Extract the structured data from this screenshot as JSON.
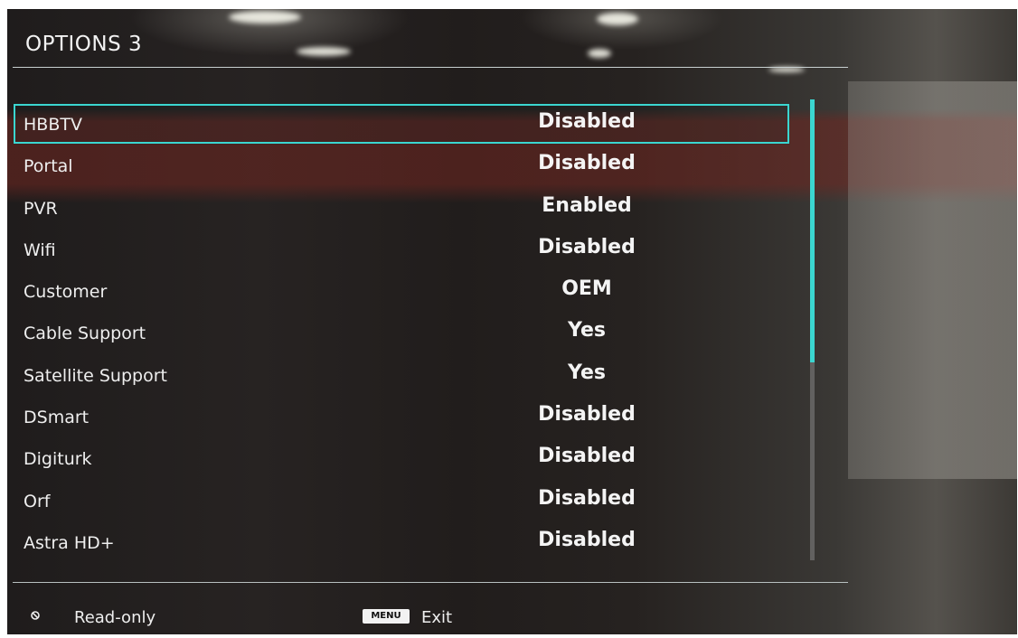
{
  "screen": {
    "title": "OPTIONS 3"
  },
  "options": [
    {
      "label": "HBBTV",
      "value": "Disabled",
      "selected": true
    },
    {
      "label": "Portal",
      "value": "Disabled",
      "selected": false
    },
    {
      "label": "PVR",
      "value": "Enabled",
      "selected": false
    },
    {
      "label": "Wifi",
      "value": "Disabled",
      "selected": false
    },
    {
      "label": "Customer",
      "value": "OEM",
      "selected": false
    },
    {
      "label": "Cable Support",
      "value": "Yes",
      "selected": false
    },
    {
      "label": "Satellite Support",
      "value": "Yes",
      "selected": false
    },
    {
      "label": "DSmart",
      "value": "Disabled",
      "selected": false
    },
    {
      "label": "Digiturk",
      "value": "Disabled",
      "selected": false
    },
    {
      "label": "Orf",
      "value": "Disabled",
      "selected": false
    },
    {
      "label": "Astra HD+",
      "value": "Disabled",
      "selected": false
    }
  ],
  "scroll": {
    "visible_fraction": 0.57
  },
  "footer": {
    "readonly_icon": "circle-slash-icon",
    "readonly_label": "Read-only",
    "menu_key": "MENU",
    "exit_label": "Exit"
  },
  "colors": {
    "accent": "#3bd6d0",
    "text": "#eeeeee"
  }
}
